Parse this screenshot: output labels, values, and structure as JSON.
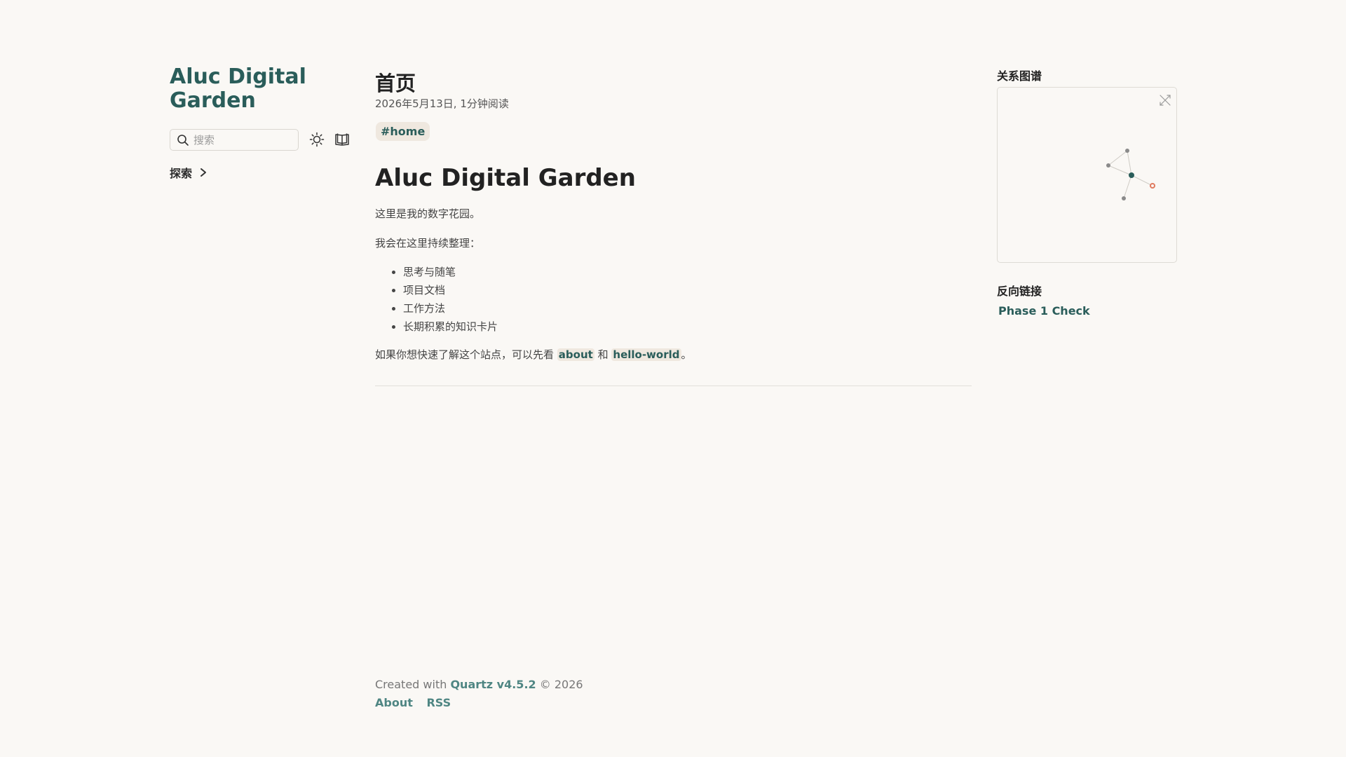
{
  "site": {
    "title": "Aluc Digital Garden"
  },
  "search": {
    "placeholder": "搜索"
  },
  "explorer": {
    "label": "探索"
  },
  "page": {
    "title": "首页",
    "meta": "2026年5月13日, 1分钟阅读",
    "tag": "#home",
    "heading": "Aluc Digital Garden",
    "intro": "这里是我的数字花园。",
    "list_intro": "我会在这里持续整理：",
    "items": [
      "思考与随笔",
      "项目文档",
      "工作方法",
      "长期积累的知识卡片"
    ],
    "outro_prefix": "如果你想快速了解这个站点，可以先看",
    "link_about": "about",
    "conj": "和",
    "link_hello": "hello-world",
    "outro_suffix": "。"
  },
  "graph": {
    "title": "关系图谱"
  },
  "backlinks": {
    "title": "反向链接",
    "items": [
      "Phase 1 Check"
    ]
  },
  "footer": {
    "created_prefix": "Created with",
    "quartz": "Quartz v4.5.2",
    "created_suffix": "© 2026",
    "links": [
      "About",
      "RSS"
    ]
  },
  "colors": {
    "accent": "#2a5d5a",
    "background": "#faf8f5",
    "tag_bg": "#efe8df",
    "graph_current_node": "#e07b5f"
  },
  "icons": {
    "search": "search-icon",
    "theme": "sun-icon",
    "reader": "book-icon",
    "chevron": "chevron-right-icon",
    "expand": "expand-icon"
  }
}
